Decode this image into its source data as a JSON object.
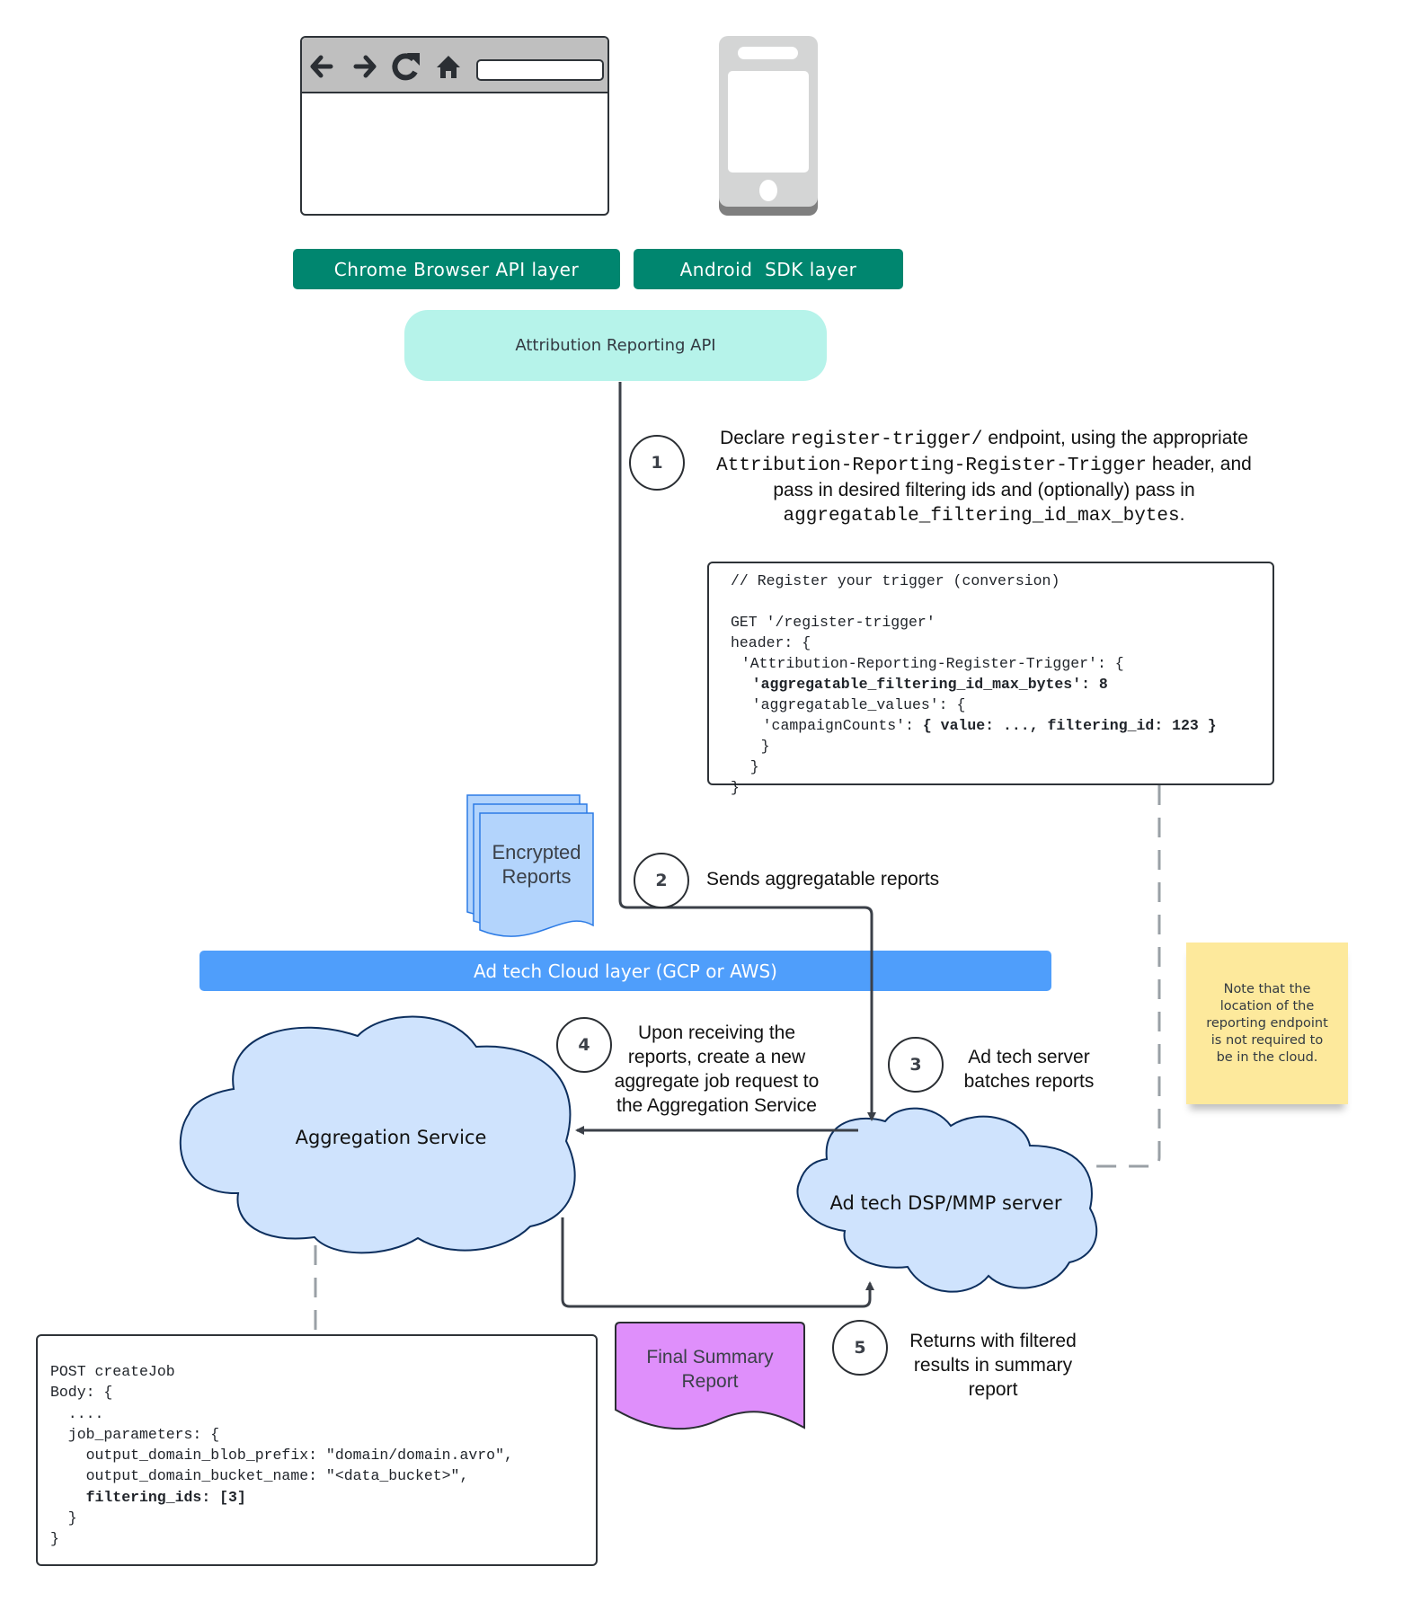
{
  "top": {
    "browser_icons": [
      "back-arrow-icon",
      "forward-arrow-icon",
      "reload-icon",
      "home-icon"
    ],
    "chrome_layer_label": "Chrome Browser API layer",
    "android_layer_label": "Android  SDK layer",
    "api_label": "Attribution Reporting API"
  },
  "steps": [
    {
      "number": "1",
      "text_parts": [
        {
          "text": "Declare ",
          "mono": false
        },
        {
          "text": "register-trigger/",
          "mono": true
        },
        {
          "text": " endpoint, using the appropriate ",
          "mono": false
        },
        {
          "text": "Attribution-Reporting-Register-Trigger",
          "mono": true
        },
        {
          "text": " header, and pass in desired filtering ids and (optionally) pass in ",
          "mono": false
        },
        {
          "text": "aggregatable_filtering_id_max_bytes",
          "mono": true
        },
        {
          "text": ".",
          "mono": false
        }
      ]
    },
    {
      "number": "2",
      "text": "Sends aggregatable reports"
    },
    {
      "number": "3",
      "lines": [
        "Ad tech server",
        "batches reports"
      ]
    },
    {
      "number": "4",
      "lines": [
        "Upon receiving the",
        "reports, create a new",
        "aggregate job request to",
        "the Aggregation Service"
      ]
    },
    {
      "number": "5",
      "lines": [
        "Returns with filtered",
        "results in summary",
        "report"
      ]
    }
  ],
  "trigger_code": {
    "lines": [
      {
        "indent": 0,
        "parts": [
          {
            "t": "// Register your trigger (conversion)",
            "b": false
          }
        ]
      },
      {
        "indent": 0,
        "parts": [
          {
            "t": "",
            "b": false
          }
        ]
      },
      {
        "indent": 0,
        "parts": [
          {
            "t": "GET '/register-trigger'",
            "b": false
          }
        ]
      },
      {
        "indent": 0,
        "parts": [
          {
            "t": "header: {",
            "b": false
          }
        ]
      },
      {
        "indent": 1,
        "parts": [
          {
            "t": "'Attribution-Reporting-Register-Trigger': {",
            "b": false
          }
        ]
      },
      {
        "indent": 2,
        "parts": [
          {
            "t": "'aggregatable_filtering_id_max_bytes': 8",
            "b": true
          }
        ]
      },
      {
        "indent": 2,
        "parts": [
          {
            "t": "'aggregatable_values': {",
            "b": false
          }
        ]
      },
      {
        "indent": 3,
        "parts": [
          {
            "t": "'campaignCounts': ",
            "b": false
          },
          {
            "t": "{ value: ..., filtering_id: 123 }",
            "b": true
          }
        ]
      },
      {
        "indent": 2,
        "parts": [
          {
            "t": " }",
            "b": false
          }
        ]
      },
      {
        "indent": 1,
        "parts": [
          {
            "t": " }",
            "b": false
          }
        ]
      },
      {
        "indent": 0,
        "parts": [
          {
            "t": "}",
            "b": false
          }
        ]
      }
    ]
  },
  "encrypted_reports_label": [
    "Encrypted",
    "Reports"
  ],
  "cloud_layer_label": "Ad tech Cloud layer (GCP or AWS)",
  "sticky_note": [
    "Note that the",
    "location of the",
    "reporting endpoint",
    "is not required to",
    "be in the cloud."
  ],
  "aggregation_service_label": "Aggregation Service",
  "dsp_server_label": "Ad tech DSP/MMP server",
  "create_job_code": {
    "lines": [
      {
        "indent": 0,
        "parts": [
          {
            "t": "POST createJob",
            "b": false
          }
        ]
      },
      {
        "indent": 0,
        "parts": [
          {
            "t": "Body: {",
            "b": false
          }
        ]
      },
      {
        "indent": 2,
        "parts": [
          {
            "t": "....",
            "b": false
          }
        ]
      },
      {
        "indent": 2,
        "parts": [
          {
            "t": "job_parameters: {",
            "b": false
          }
        ]
      },
      {
        "indent": 4,
        "parts": [
          {
            "t": "output_domain_blob_prefix: \"domain/domain.avro\",",
            "b": false
          }
        ]
      },
      {
        "indent": 4,
        "parts": [
          {
            "t": "output_domain_bucket_name: \"<data_bucket>\",",
            "b": false
          }
        ]
      },
      {
        "indent": 4,
        "parts": [
          {
            "t": "filtering_ids: [3]",
            "b": true
          }
        ]
      },
      {
        "indent": 1,
        "parts": [
          {
            "t": " }",
            "b": false
          }
        ]
      },
      {
        "indent": 0,
        "parts": [
          {
            "t": "}",
            "b": false
          }
        ]
      }
    ]
  },
  "final_report_label": [
    "Final Summary",
    "Report"
  ],
  "colors": {
    "teal_layer": "#00866f",
    "api_fill": "#b6f3ea",
    "cloud_bar": "#4f9efb",
    "cloud_fill": "#cfe3fd",
    "cloud_stroke": "#0d2f5e",
    "encrypted_fill": "#b3d4fc",
    "final_report_fill": "#df8ffb",
    "sticky_fill": "#fde99c",
    "connector": "#3b4048",
    "dashed": "#9aa0a6"
  }
}
